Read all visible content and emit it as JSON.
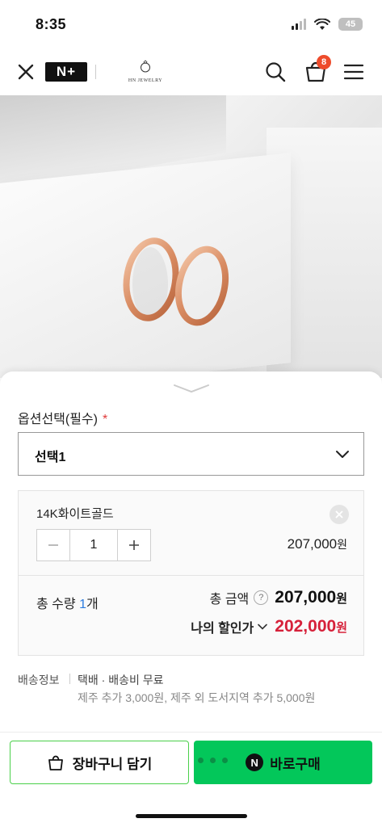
{
  "status_bar": {
    "time": "8:35",
    "battery": "45"
  },
  "header": {
    "nplus_logo": "N+",
    "brand_logo_text": "HN JEWELRY",
    "cart_badge": "8"
  },
  "sheet": {
    "option_label": "옵션선택(필수)",
    "required_mark": "*",
    "select_value": "선택1",
    "selected_item": {
      "name": "14K화이트골드",
      "quantity": "1",
      "price": "207,000",
      "price_unit": "원"
    },
    "totals": {
      "qty_label": "총 수량",
      "qty_value": "1",
      "qty_unit": "개",
      "amount_label": "총 금액",
      "help": "?",
      "amount_value": "207,000",
      "amount_unit": "원",
      "discount_label": "나의 할인가",
      "discount_value": "202,000",
      "discount_unit": "원"
    },
    "shipping": {
      "label": "배송정보",
      "value": "택배 · 배송비 무료",
      "extra": "제주 추가 3,000원, 제주 외 도서지역 추가 5,000원"
    },
    "buttons": {
      "cart_add": "장바구니 담기",
      "npay": "N",
      "buy_now": "바로구매"
    }
  },
  "colors": {
    "buy_green": "#03c75a",
    "discount_red": "#d6213a",
    "badge_red": "#ee4b2b",
    "qty_blue": "#2a7be0"
  }
}
